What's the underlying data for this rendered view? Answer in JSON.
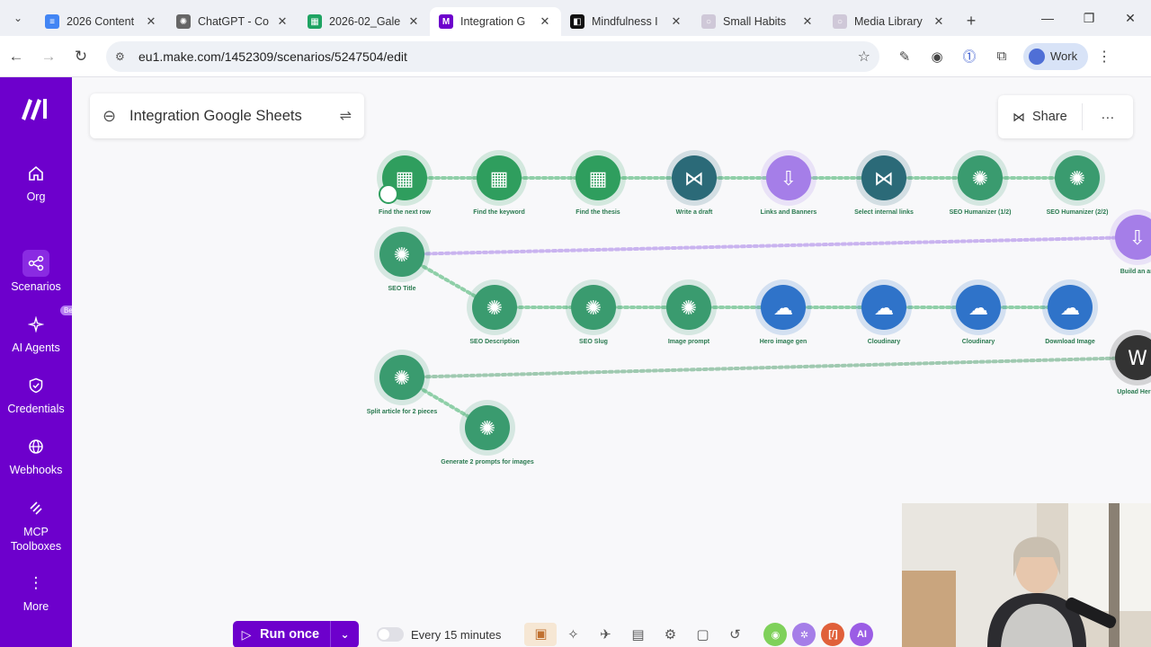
{
  "browser": {
    "tabs": [
      {
        "label": "2026 Content",
        "color": "#4285f4",
        "glyph": "≡"
      },
      {
        "label": "ChatGPT - Co",
        "color": "#666666",
        "glyph": "✺"
      },
      {
        "label": "2026-02_Gale",
        "color": "#1ea362",
        "glyph": "▦"
      },
      {
        "label": "Integration G",
        "color": "#6d00cc",
        "glyph": "M",
        "active": true
      },
      {
        "label": "Mindfulness I",
        "color": "#111111",
        "glyph": "◧"
      },
      {
        "label": "Small Habits",
        "color": "#cfc8d8",
        "glyph": "○"
      },
      {
        "label": "Media Library",
        "color": "#cfc8d8",
        "glyph": "○"
      }
    ],
    "url": "eu1.make.com/1452309/scenarios/5247504/edit",
    "profile": "Work"
  },
  "sidebar": {
    "items": [
      {
        "label": "Org",
        "icon": "home-icon"
      },
      {
        "label": "Scenarios",
        "icon": "share-nodes-icon",
        "active": true
      },
      {
        "label": "AI Agents",
        "icon": "ai-agent-icon",
        "badge": "Beta"
      },
      {
        "label": "Credentials",
        "icon": "shield-icon"
      },
      {
        "label": "Webhooks",
        "icon": "globe-icon"
      },
      {
        "label": "MCP\nToolboxes",
        "icon": "mcp-icon"
      },
      {
        "label": "More",
        "icon": "more-vertical-icon"
      }
    ]
  },
  "scenario": {
    "title": "Integration Google Sheets",
    "share_label": "Share",
    "more_label": "···"
  },
  "colors": {
    "sheets": "#2f9e5e",
    "openai": "#3a9b6f",
    "teal": "#2b6a78",
    "violet": "#a57ee8",
    "blue": "#2f73c9",
    "wordpress": "#333333",
    "connector": "#8fcfa8",
    "connector_purple": "#c9b3ef",
    "brand": "#6d00cc"
  },
  "nodes": [
    {
      "label": "Find the next row",
      "type": "sheets"
    },
    {
      "label": "Find the keyword",
      "type": "sheets"
    },
    {
      "label": "Find the thesis",
      "type": "sheets"
    },
    {
      "label": "Write a draft",
      "type": "teal"
    },
    {
      "label": "Links and Banners",
      "type": "violet"
    },
    {
      "label": "Select internal links",
      "type": "teal"
    },
    {
      "label": "SEO Humanizer (1/2)",
      "type": "openai"
    },
    {
      "label": "SEO Humanizer (2/2)",
      "type": "openai"
    },
    {
      "label": "SEO Title",
      "type": "openai"
    },
    {
      "label": "Build an art",
      "type": "violet"
    },
    {
      "label": "SEO Description",
      "type": "openai"
    },
    {
      "label": "SEO Slug",
      "type": "openai"
    },
    {
      "label": "Image prompt",
      "type": "openai"
    },
    {
      "label": "Hero image gen",
      "type": "blue"
    },
    {
      "label": "Cloudinary",
      "type": "blue"
    },
    {
      "label": "Cloudinary",
      "type": "blue"
    },
    {
      "label": "Download Image",
      "type": "blue"
    },
    {
      "label": "Upload Hero I",
      "type": "wordpress"
    },
    {
      "label": "Split article for 2 pieces",
      "type": "openai"
    },
    {
      "label": "Generate 2 prompts for images",
      "type": "openai"
    }
  ],
  "toolbar": {
    "run_label": "Run once",
    "schedule": "Every 15 minutes",
    "apps": [
      {
        "color": "#7fd15a",
        "glyph": "◉"
      },
      {
        "color": "#a57ee8",
        "glyph": "✲"
      },
      {
        "color": "#e0603a",
        "glyph": "[/]"
      },
      {
        "color": "#9b5de5",
        "glyph": "AI"
      }
    ]
  }
}
